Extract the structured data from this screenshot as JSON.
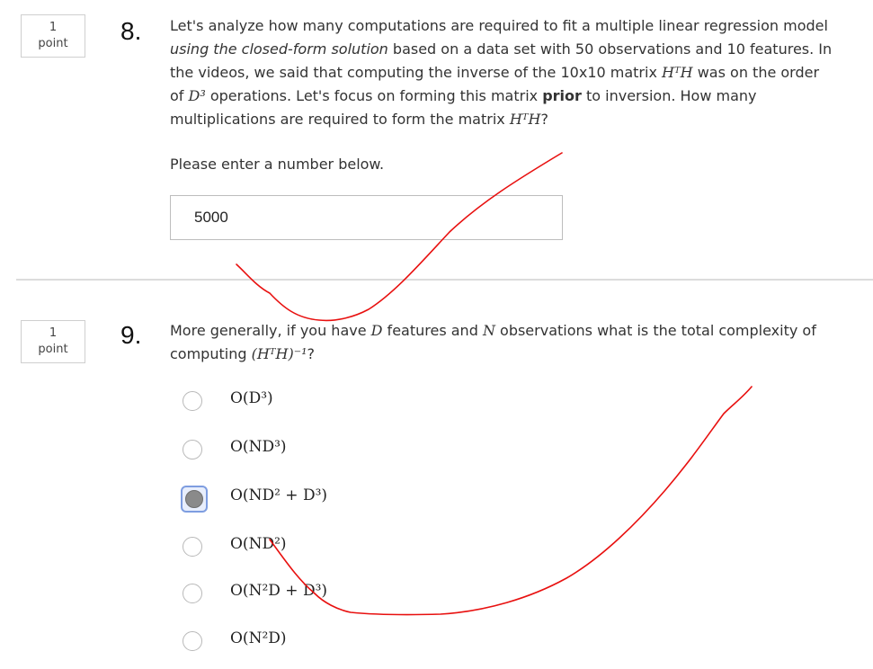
{
  "q8": {
    "points_value": "1",
    "points_label": "point",
    "number": "8.",
    "text": {
      "p1": "Let's analyze how many computations are required to fit a multiple linear regression model ",
      "p2": "using the closed-form solution",
      "p3": " based on a data set with 50 observations and 10 features. In the videos, we said that computing the inverse of the 10x10 matrix ",
      "m1": "HᵀH",
      "p4": " was on the order of ",
      "m2": "D³",
      "p5": " operations. Let's focus on forming this matrix ",
      "p6": "prior",
      "p7": " to inversion. How many multiplications are required to form the matrix ",
      "m3": "HᵀH",
      "p8": "?"
    },
    "prompt": "Please enter a number below.",
    "answer_value": "5000"
  },
  "q9": {
    "points_value": "1",
    "points_label": "point",
    "number": "9.",
    "text": {
      "p1": "More generally, if you have ",
      "m1": "D",
      "p2": " features and ",
      "m2": "N",
      "p3": " observations what is the total complexity of computing ",
      "m3": "(HᵀH)⁻¹",
      "p4": "?"
    },
    "options": [
      {
        "label": "O(D³)",
        "selected": false
      },
      {
        "label": "O(ND³)",
        "selected": false
      },
      {
        "label": "O(ND² + D³)",
        "selected": true
      },
      {
        "label": "O(ND²)",
        "selected": false
      },
      {
        "label": "O(N²D + D³)",
        "selected": false
      },
      {
        "label": "O(N²D)",
        "selected": false
      }
    ]
  },
  "colors": {
    "annotation": "#e8100f",
    "selected_radio_border": "#7e9de0"
  }
}
